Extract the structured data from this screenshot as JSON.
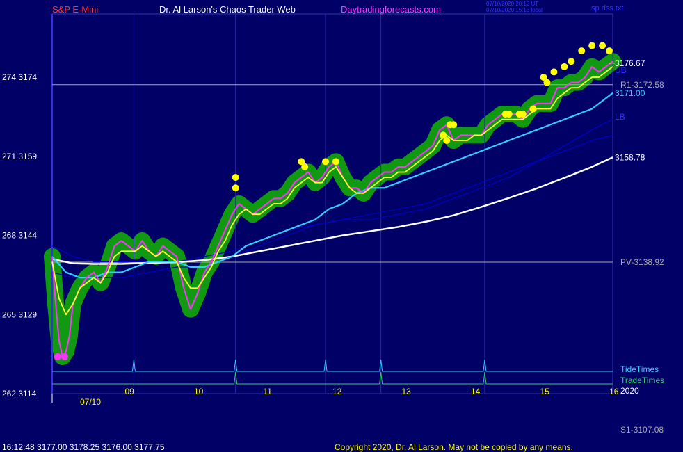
{
  "header": {
    "symbol": "S&P E-Mini",
    "title": "Dr. Al Larson's Chaos Trader Web",
    "site": "Daytradingforecasts.com",
    "stamp_utc": "07/10/2020 20:13 UT",
    "stamp_local": "07/10/2020 15:13 local",
    "file": "sp.riss.txt"
  },
  "footer": {
    "quote": "16:12:48  3177.00  3178.25  3176.00  3177.75",
    "copyright": "Copyright 2020, Dr. Al Larson. May not be copied by any means."
  },
  "colors": {
    "background": "#000066",
    "grid": "#aaaaaa",
    "price": "#ff33ff",
    "fast_ma": "#ffff33",
    "mid_ma": "#33ccff",
    "slow_ma": "#ffffff",
    "band": "#0000cc",
    "glow": "#119911",
    "tide": "#33ccff",
    "trade": "#33cc66",
    "highlight": "#ffff00"
  },
  "chart_data": {
    "type": "line",
    "ylim": [
      3114,
      3186
    ],
    "xlim": [
      8.0,
      16.1
    ],
    "y_ticks": [
      {
        "cycle": "262",
        "price": 3114
      },
      {
        "cycle": "265",
        "price": 3129
      },
      {
        "cycle": "268",
        "price": 3144
      },
      {
        "cycle": "271",
        "price": 3159
      },
      {
        "cycle": "274",
        "price": 3174
      }
    ],
    "x_ticks": [
      "09",
      "10",
      "11",
      "12",
      "13",
      "14",
      "15",
      "16"
    ],
    "date_label": "07/10",
    "year_label": "2020",
    "hlines": [
      {
        "label": "R1-3172.58",
        "value": 3172.58
      },
      {
        "label": "PV-3138.92",
        "value": 3138.92
      }
    ],
    "outside_label": "S1-3107.08",
    "right_labels": [
      {
        "text": "3176.67",
        "value": 3176.67,
        "color": "#ffffff"
      },
      {
        "text": "3171.00",
        "value": 3171.0,
        "color": "#33ccff"
      },
      {
        "text": "3158.78",
        "value": 3158.78,
        "color": "#ffffff"
      },
      {
        "text": "LB",
        "value": 3166.5,
        "color": "#3333ff"
      },
      {
        "text": "UB",
        "value": 3175.3,
        "color": "#3333ff"
      }
    ],
    "tide_times": [
      9.18,
      10.65,
      11.95,
      12.75,
      14.25
    ],
    "trade_times": [
      10.65,
      12.75,
      14.25
    ],
    "tide_label": "TideTimes",
    "trade_label": "TradeTimes",
    "series": [
      {
        "key": "price",
        "x": [
          8.0,
          8.05,
          8.1,
          8.15,
          8.2,
          8.25,
          8.3,
          8.4,
          8.5,
          8.6,
          8.7,
          8.8,
          8.9,
          9.0,
          9.1,
          9.2,
          9.3,
          9.4,
          9.5,
          9.6,
          9.7,
          9.8,
          9.9,
          10.0,
          10.1,
          10.2,
          10.3,
          10.4,
          10.5,
          10.6,
          10.7,
          10.8,
          10.9,
          11.0,
          11.1,
          11.2,
          11.3,
          11.4,
          11.5,
          11.6,
          11.7,
          11.8,
          11.9,
          12.0,
          12.1,
          12.2,
          12.3,
          12.4,
          12.5,
          12.6,
          12.7,
          12.8,
          12.9,
          13.0,
          13.1,
          13.2,
          13.3,
          13.4,
          13.5,
          13.6,
          13.7,
          13.8,
          13.9,
          14.0,
          14.1,
          14.2,
          14.3,
          14.4,
          14.5,
          14.6,
          14.7,
          14.8,
          14.9,
          15.0,
          15.1,
          15.2,
          15.3,
          15.4,
          15.5,
          15.6,
          15.7,
          15.8,
          15.9,
          16.0,
          16.1
        ],
        "y": [
          3140,
          3131,
          3124,
          3121,
          3122,
          3125,
          3131,
          3134,
          3136,
          3137,
          3135,
          3138,
          3142,
          3143,
          3142,
          3141,
          3143,
          3141,
          3140,
          3142,
          3141,
          3140,
          3134,
          3130,
          3133,
          3137,
          3139,
          3142,
          3145,
          3148,
          3150,
          3149,
          3148,
          3149,
          3150,
          3151,
          3151,
          3152,
          3154,
          3155,
          3156,
          3154,
          3155,
          3157,
          3158,
          3155,
          3153,
          3153,
          3152,
          3154,
          3155,
          3156,
          3156,
          3157,
          3157,
          3158,
          3159,
          3160,
          3161,
          3164,
          3165,
          3162,
          3163,
          3163,
          3163,
          3163,
          3165,
          3166,
          3167,
          3167,
          3167,
          3166,
          3168,
          3169,
          3169,
          3169,
          3172,
          3172,
          3173,
          3173,
          3174,
          3176,
          3175,
          3176,
          3177
        ]
      },
      {
        "key": "fast_ma",
        "x": [
          8.0,
          8.1,
          8.2,
          8.3,
          8.4,
          8.5,
          8.6,
          8.7,
          8.8,
          8.9,
          9.0,
          9.1,
          9.2,
          9.3,
          9.4,
          9.5,
          9.6,
          9.7,
          9.8,
          9.9,
          10.0,
          10.1,
          10.2,
          10.3,
          10.4,
          10.5,
          10.6,
          10.7,
          10.8,
          10.9,
          11.0,
          11.1,
          11.2,
          11.3,
          11.4,
          11.5,
          11.6,
          11.7,
          11.8,
          11.9,
          12.0,
          12.1,
          12.2,
          12.3,
          12.4,
          12.5,
          12.6,
          12.7,
          12.8,
          12.9,
          13.0,
          13.1,
          13.2,
          13.3,
          13.4,
          13.5,
          13.6,
          13.7,
          13.8,
          13.9,
          14.0,
          14.1,
          14.2,
          14.3,
          14.4,
          14.5,
          14.6,
          14.7,
          14.8,
          14.9,
          15.0,
          15.1,
          15.2,
          15.3,
          15.4,
          15.5,
          15.6,
          15.7,
          15.8,
          15.9,
          16.0,
          16.1
        ],
        "y": [
          3139,
          3132,
          3129,
          3131,
          3134,
          3135,
          3136,
          3135,
          3137,
          3140,
          3141,
          3141,
          3141,
          3142,
          3141,
          3140,
          3141,
          3140,
          3139,
          3136,
          3134,
          3134,
          3136,
          3138,
          3141,
          3143,
          3146,
          3148,
          3149,
          3148,
          3148,
          3149,
          3150,
          3150,
          3151,
          3153,
          3154,
          3155,
          3154,
          3154,
          3156,
          3157,
          3155,
          3153,
          3152,
          3152,
          3153,
          3154,
          3155,
          3155,
          3156,
          3156,
          3157,
          3158,
          3159,
          3160,
          3162,
          3163,
          3162,
          3162,
          3162,
          3163,
          3163,
          3164,
          3165,
          3166,
          3166,
          3166,
          3166,
          3167,
          3168,
          3168,
          3168,
          3170,
          3171,
          3172,
          3172,
          3173,
          3174,
          3174,
          3175,
          3176
        ]
      },
      {
        "key": "mid_ma",
        "x": [
          8.0,
          8.2,
          8.4,
          8.6,
          8.8,
          9.0,
          9.2,
          9.4,
          9.6,
          9.8,
          10.0,
          10.2,
          10.4,
          10.6,
          10.8,
          11.0,
          11.2,
          11.4,
          11.6,
          11.8,
          12.0,
          12.2,
          12.4,
          12.6,
          12.8,
          13.0,
          13.2,
          13.4,
          13.6,
          13.8,
          14.0,
          14.2,
          14.4,
          14.6,
          14.8,
          15.0,
          15.2,
          15.4,
          15.6,
          15.8,
          16.0,
          16.1
        ],
        "y": [
          3140,
          3137,
          3136,
          3136,
          3137,
          3137,
          3138,
          3139,
          3139,
          3139,
          3138,
          3138,
          3139,
          3140,
          3142,
          3143,
          3144,
          3145,
          3146,
          3147,
          3149,
          3150,
          3152,
          3153,
          3153,
          3154,
          3155,
          3156,
          3157,
          3158,
          3159,
          3160,
          3161,
          3162,
          3163,
          3164,
          3165,
          3166,
          3167,
          3168,
          3170,
          3171
        ]
      },
      {
        "key": "slow_ma",
        "x": [
          8.0,
          8.3,
          8.6,
          9.0,
          9.4,
          9.8,
          10.2,
          10.6,
          11.0,
          11.4,
          11.8,
          12.2,
          12.6,
          13.0,
          13.4,
          13.8,
          14.2,
          14.6,
          15.0,
          15.4,
          15.8,
          16.1
        ],
        "y": [
          3139.5,
          3138.7,
          3138.6,
          3138.6,
          3138.8,
          3138.9,
          3139.3,
          3140.0,
          3141.0,
          3142.0,
          3143.0,
          3144.0,
          3144.8,
          3145.6,
          3146.6,
          3147.8,
          3149.4,
          3151.1,
          3152.9,
          3154.9,
          3157.0,
          3158.8
        ]
      },
      {
        "key": "band_upper",
        "x": [
          8.0,
          8.3,
          8.6,
          9.0,
          9.4,
          9.8,
          10.2,
          10.6,
          11.0,
          11.4,
          11.8,
          12.2,
          12.6,
          13.0,
          13.4,
          13.8,
          14.2,
          14.6,
          15.0,
          15.4,
          15.8,
          16.1
        ],
        "y": [
          3142,
          3140,
          3139,
          3139,
          3139,
          3139,
          3140,
          3141,
          3143,
          3145,
          3146,
          3147,
          3147,
          3148,
          3149,
          3151,
          3153,
          3155,
          3158,
          3161,
          3164,
          3166
        ]
      },
      {
        "key": "band_lower",
        "x": [
          8.0,
          8.3,
          8.6,
          9.0,
          9.4,
          9.8,
          10.2,
          10.6,
          11.0,
          11.4,
          11.8,
          12.2,
          12.6,
          13.0,
          13.4,
          13.8,
          14.2,
          14.6,
          15.0,
          15.4,
          15.8,
          16.1
        ],
        "y": [
          3137,
          3136,
          3136,
          3136,
          3137,
          3138,
          3138,
          3140,
          3142,
          3144,
          3146,
          3147,
          3148,
          3149,
          3150,
          3152,
          3154,
          3156,
          3158,
          3160,
          3162,
          3163
        ]
      }
    ],
    "highlights": [
      [
        10.65,
        3155
      ],
      [
        10.65,
        3153
      ],
      [
        11.6,
        3158
      ],
      [
        11.65,
        3157
      ],
      [
        11.95,
        3158
      ],
      [
        12.1,
        3158
      ],
      [
        13.65,
        3163
      ],
      [
        13.7,
        3162
      ],
      [
        13.75,
        3165
      ],
      [
        13.8,
        3165
      ],
      [
        14.55,
        3167
      ],
      [
        14.6,
        3167
      ],
      [
        14.75,
        3167
      ],
      [
        14.8,
        3167
      ],
      [
        14.95,
        3168
      ],
      [
        15.1,
        3174
      ],
      [
        15.15,
        3173
      ],
      [
        15.25,
        3175
      ],
      [
        15.4,
        3176
      ],
      [
        15.5,
        3177
      ],
      [
        15.65,
        3179
      ],
      [
        15.8,
        3180
      ],
      [
        15.95,
        3180
      ],
      [
        16.05,
        3179
      ]
    ]
  }
}
